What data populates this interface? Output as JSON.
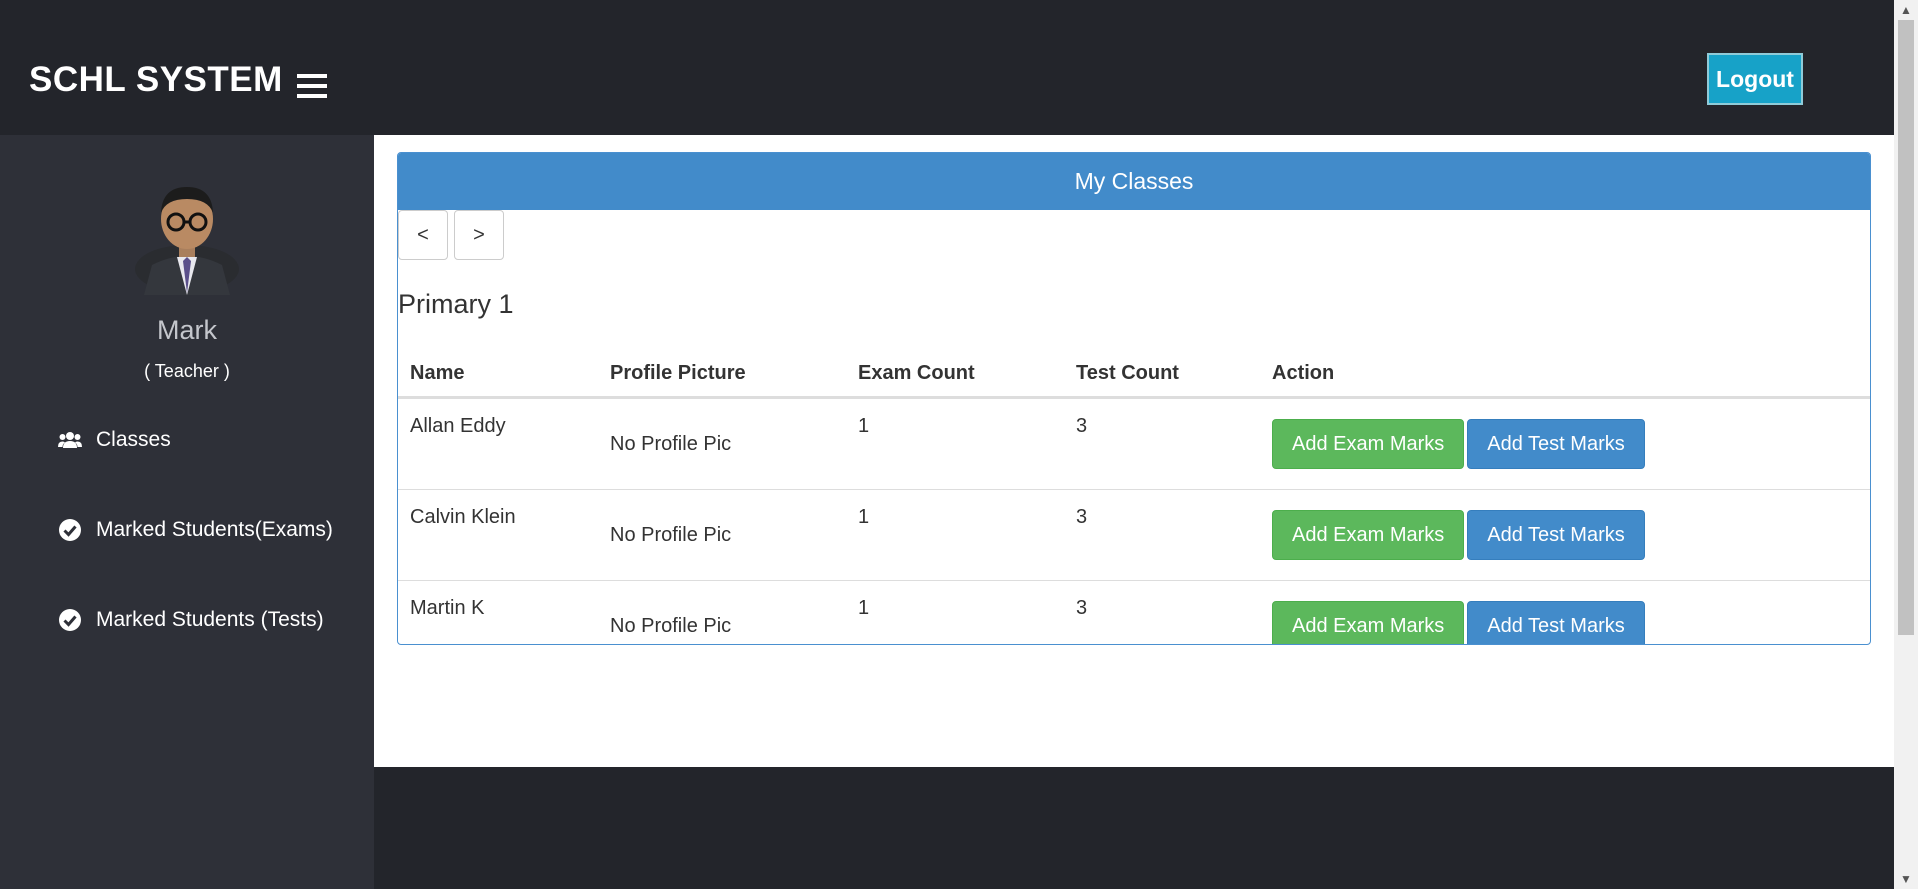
{
  "header": {
    "brand": "SCHL SYSTEM",
    "logout_label": "Logout"
  },
  "sidebar": {
    "user_name": "Mark",
    "user_role": "( Teacher )",
    "items": [
      {
        "label": "Classes",
        "icon": "users-icon"
      },
      {
        "label": "Marked Students(Exams)",
        "icon": "check-circle-icon"
      },
      {
        "label": "Marked Students (Tests)",
        "icon": "check-circle-icon"
      }
    ]
  },
  "panel": {
    "title": "My Classes",
    "prev_label": "<",
    "next_label": ">",
    "class_name": "Primary 1",
    "columns": [
      "Name",
      "Profile Picture",
      "Exam Count",
      "Test Count",
      "Action"
    ],
    "rows": [
      {
        "name": "Allan Eddy",
        "pic": "No Profile Pic",
        "exam": "1",
        "test": "3"
      },
      {
        "name": "Calvin Klein",
        "pic": "No Profile Pic",
        "exam": "1",
        "test": "3"
      },
      {
        "name": "Martin K",
        "pic": "No Profile Pic",
        "exam": "1",
        "test": "3"
      }
    ],
    "add_exam_label": "Add Exam Marks",
    "add_test_label": "Add Test Marks"
  },
  "colors": {
    "topbar": "#23252b",
    "sidebar": "#2e3038",
    "primary": "#428bca",
    "success": "#5cb85c",
    "logout": "#17a2c8"
  }
}
